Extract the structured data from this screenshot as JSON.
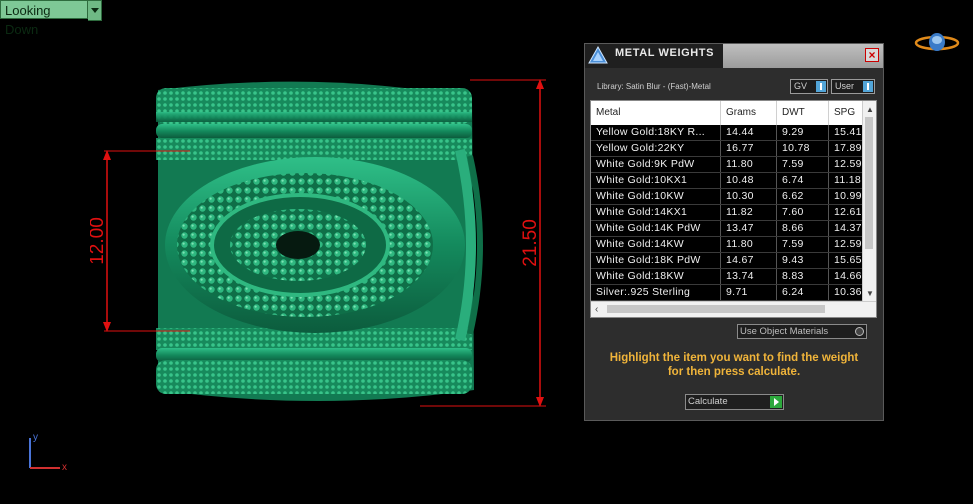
{
  "viewport": {
    "view_label": "Looking Down",
    "dimension_left": "12.00",
    "dimension_right": "21.50",
    "axis_y": "y",
    "axis_x": "x"
  },
  "panel": {
    "title": "METAL WEIGHTS",
    "close": "×",
    "library": "Library: Satin Blur - (Fast)-Metal",
    "gv_label": "GV",
    "user_label": "User",
    "columns": [
      "Metal",
      "Grams",
      "DWT",
      "SPG"
    ],
    "rows": [
      [
        "Yellow Gold:18KY R...",
        "14.44",
        "9.29",
        "15.41"
      ],
      [
        "Yellow Gold:22KY",
        "16.77",
        "10.78",
        "17.89"
      ],
      [
        "White Gold:9K PdW",
        "11.80",
        "7.59",
        "12.59"
      ],
      [
        "White Gold:10KX1",
        "10.48",
        "6.74",
        "11.18"
      ],
      [
        "White Gold:10KW",
        "10.30",
        "6.62",
        "10.99"
      ],
      [
        "White Gold:14KX1",
        "11.82",
        "7.60",
        "12.61"
      ],
      [
        "White Gold:14K PdW",
        "13.47",
        "8.66",
        "14.37"
      ],
      [
        "White Gold:14KW",
        "11.80",
        "7.59",
        "12.59"
      ],
      [
        "White Gold:18K PdW",
        "14.67",
        "9.43",
        "15.65"
      ],
      [
        "White Gold:18KW",
        "13.74",
        "8.83",
        "14.66"
      ],
      [
        "Silver:.925 Sterling",
        "9.71",
        "6.24",
        "10.36"
      ]
    ],
    "use_object_materials": "Use Object Materials",
    "instruction_line1": "Highlight the item you want to find the weight",
    "instruction_line2": "for then press calculate.",
    "calculate": "Calculate"
  },
  "colors": {
    "ring_green": "#1f9a6a",
    "dimension_red": "#e01010",
    "instruction_orange": "#f0b43a",
    "view_label_bg": "#7ec896"
  }
}
